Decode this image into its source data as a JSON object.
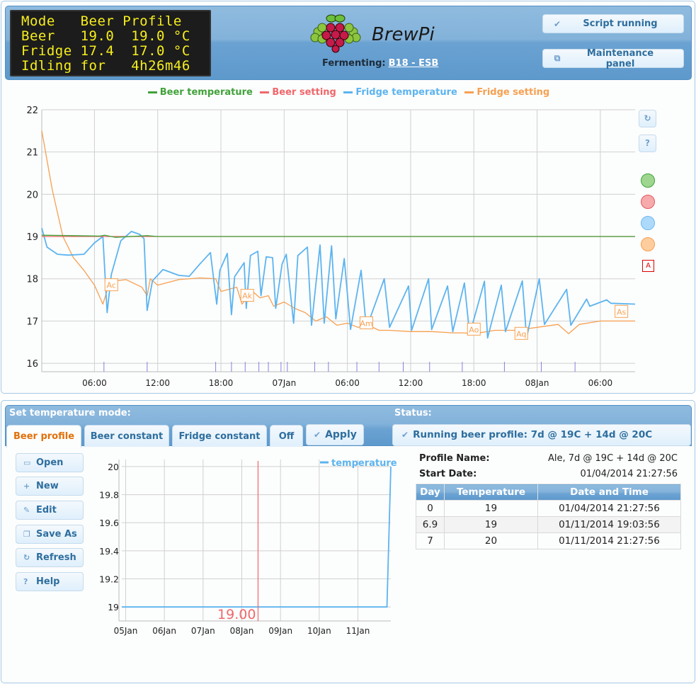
{
  "lcd": {
    "lines": [
      "Mode   Beer Profile",
      "Beer   19.0  19.0 °C",
      "Fridge 17.4  17.0 °C",
      "Idling for   4h26m46"
    ]
  },
  "header": {
    "logo_text": "BrewPi",
    "fermenting_label": "Fermenting:",
    "fermenting_beer": "B18 - ESB",
    "script_button": "Script running",
    "maintenance_button": "Maintenance panel"
  },
  "colors": {
    "beer_temp": "#41a23a",
    "beer_set": "#f0676a",
    "fridge_temp": "#5cb4f0",
    "fridge_set": "#f7a050",
    "accent_orange": "#e17009",
    "button_text": "#2e6e9e"
  },
  "main_chart_controls": {
    "refresh_icon": "↻",
    "help_label": "?",
    "annotation_toggle": "A"
  },
  "chart_data": [
    {
      "type": "line",
      "title": "",
      "xlabel": "",
      "ylabel": "",
      "ylim": [
        15.8,
        22
      ],
      "yticks": [
        16,
        17,
        18,
        19,
        20,
        21,
        22
      ],
      "x_unit": "hours since 06 Jan 00:00",
      "xlim": [
        1,
        57.3
      ],
      "xticks": [
        {
          "x": 6,
          "label": "06:00"
        },
        {
          "x": 12,
          "label": "12:00"
        },
        {
          "x": 18,
          "label": "18:00"
        },
        {
          "x": 24,
          "label": "07Jan"
        },
        {
          "x": 30,
          "label": "06:00"
        },
        {
          "x": 36,
          "label": "12:00"
        },
        {
          "x": 42,
          "label": "18:00"
        },
        {
          "x": 48,
          "label": "08Jan"
        },
        {
          "x": 54,
          "label": "06:00"
        }
      ],
      "legend": [
        "Beer temperature",
        "Beer setting",
        "Fridge temperature",
        "Fridge setting"
      ],
      "legend_position": "top-center",
      "grid": true,
      "series": [
        {
          "name": "Beer temperature",
          "color": "#41a23a",
          "x": [
            1,
            4,
            6.5,
            7,
            8,
            11,
            12,
            18,
            57.3
          ],
          "y": [
            19.03,
            19.02,
            19.01,
            19.03,
            18.98,
            19.02,
            19.0,
            19.0,
            19.0
          ]
        },
        {
          "name": "Beer setting",
          "color": "#f0676a",
          "x": [
            1,
            57.3
          ],
          "y": [
            19.0,
            19.0
          ]
        },
        {
          "name": "Fridge temperature",
          "color": "#5cb4f0",
          "x": [
            1,
            1.5,
            2.5,
            3.5,
            5,
            6,
            6.8,
            7.2,
            7.6,
            8.5,
            9.5,
            10.3,
            10.7,
            11.0,
            11.5,
            12.5,
            14,
            15,
            16,
            17,
            17.6,
            17.9,
            18.6,
            19.0,
            19.3,
            20.2,
            20.4,
            20.8,
            21.5,
            21.8,
            22.3,
            22.9,
            23.2,
            23.8,
            24.2,
            24.9,
            25.3,
            26.2,
            26.6,
            27.4,
            27.8,
            28.5,
            28.9,
            29.7,
            30.3,
            31.3,
            31.8,
            33.5,
            34.0,
            35.8,
            36.1,
            37.7,
            38.0,
            39.5,
            40.0,
            41.1,
            41.6,
            43.0,
            43.3,
            44.6,
            45.0,
            46.6,
            47.0,
            48.2,
            48.7,
            50.8,
            51.2,
            52.7,
            53.0,
            54.6,
            55.0,
            57.3
          ],
          "y": [
            19.2,
            18.75,
            18.58,
            18.56,
            18.58,
            18.85,
            19.0,
            17.2,
            18.1,
            18.9,
            19.12,
            19.05,
            18.95,
            17.25,
            17.95,
            18.22,
            18.08,
            18.06,
            18.35,
            18.62,
            17.4,
            18.2,
            18.6,
            17.15,
            18.05,
            18.38,
            17.3,
            18.55,
            18.65,
            17.6,
            18.52,
            18.5,
            17.3,
            18.35,
            18.58,
            16.95,
            18.55,
            18.75,
            16.9,
            18.8,
            16.95,
            18.78,
            17.05,
            18.48,
            16.8,
            18.2,
            16.82,
            18.0,
            16.85,
            17.83,
            16.78,
            18.0,
            16.8,
            17.83,
            16.75,
            17.9,
            16.68,
            17.94,
            16.6,
            17.85,
            16.75,
            17.95,
            16.6,
            18.0,
            16.92,
            17.75,
            16.9,
            17.52,
            17.35,
            17.5,
            17.42,
            17.4
          ]
        },
        {
          "name": "Fridge setting",
          "color": "#f7a050",
          "x": [
            1,
            2,
            3,
            4,
            5,
            6,
            6.8,
            7.3,
            8,
            9,
            10.5,
            11.0,
            11.3,
            12,
            14,
            16,
            17.5,
            18,
            19.5,
            20,
            21,
            21.7,
            22.5,
            23,
            24,
            25,
            26,
            27,
            28,
            29,
            30,
            31,
            32,
            33,
            34,
            36,
            38,
            40,
            41,
            42,
            44,
            46,
            48,
            50,
            51,
            52,
            54,
            57.3
          ],
          "y": [
            21.5,
            20.1,
            19.0,
            18.5,
            18.2,
            17.85,
            17.4,
            17.8,
            17.95,
            17.98,
            17.8,
            17.6,
            18.0,
            17.85,
            17.98,
            18.02,
            18.0,
            17.7,
            17.8,
            17.4,
            17.7,
            17.55,
            17.6,
            17.35,
            17.45,
            17.3,
            17.2,
            17.0,
            17.1,
            16.9,
            16.95,
            16.85,
            16.9,
            16.78,
            16.78,
            16.75,
            16.75,
            16.72,
            16.72,
            16.7,
            16.78,
            16.78,
            16.85,
            16.92,
            16.7,
            16.92,
            17.0,
            17.0
          ]
        }
      ],
      "annotations": [
        {
          "label": "Ac",
          "x": 7.6,
          "y": 17.85
        },
        {
          "label": "Ak",
          "x": 20.5,
          "y": 17.6
        },
        {
          "label": "Am",
          "x": 31.8,
          "y": 16.95
        },
        {
          "label": "Ao",
          "x": 42.0,
          "y": 16.8
        },
        {
          "label": "Aq",
          "x": 46.5,
          "y": 16.7
        },
        {
          "label": "As",
          "x": 56.0,
          "y": 17.22
        }
      ],
      "event_markers_x": [
        6.9,
        11.0,
        17.5,
        19.0,
        20.3,
        21.6,
        22.5,
        23.7,
        24.3,
        26.9,
        28.2,
        30.9,
        33.0,
        35.3,
        37.8,
        40.9,
        44.9,
        48.4,
        51.6
      ]
    },
    {
      "type": "line",
      "title": "",
      "xlabel": "",
      "ylabel": "",
      "ylim": [
        18.9,
        20.05
      ],
      "yticks": [
        19,
        19.2,
        19.4,
        19.6,
        19.8,
        20
      ],
      "x_unit": "days since 05 Jan 00:00",
      "xlim": [
        -0.1,
        6.85
      ],
      "xticks": [
        {
          "x": 0,
          "label": "05Jan"
        },
        {
          "x": 1,
          "label": "06Jan"
        },
        {
          "x": 2,
          "label": "07Jan"
        },
        {
          "x": 3,
          "label": "08Jan"
        },
        {
          "x": 4,
          "label": "09Jan"
        },
        {
          "x": 5,
          "label": "10Jan"
        },
        {
          "x": 6,
          "label": "11Jan"
        }
      ],
      "legend": [
        "temperature"
      ],
      "legend_position": "top-right",
      "grid": true,
      "series": [
        {
          "name": "temperature",
          "color": "#5cb4f0",
          "x": [
            -0.1,
            6.75,
            6.85
          ],
          "y": [
            19,
            19,
            20
          ]
        }
      ],
      "now_marker": {
        "x": 3.42,
        "label": "19.00",
        "color": "#f0676a"
      }
    }
  ],
  "mode": {
    "title": "Set temperature mode:",
    "tabs": [
      "Beer profile",
      "Beer constant",
      "Fridge constant",
      "Off"
    ],
    "active_tab": 0,
    "apply_label": "Apply"
  },
  "status": {
    "title": "Status:",
    "text": "Running beer profile: 7d @ 19C + 14d @ 20C"
  },
  "profile_buttons": [
    {
      "label": "Open",
      "icon": "folder-open-icon",
      "glyph": "▭"
    },
    {
      "label": "New",
      "icon": "plus-icon",
      "glyph": "+"
    },
    {
      "label": "Edit",
      "icon": "wrench-icon",
      "glyph": "✎"
    },
    {
      "label": "Save As",
      "icon": "copy-icon",
      "glyph": "❐"
    },
    {
      "label": "Refresh",
      "icon": "refresh-icon",
      "glyph": "↻"
    },
    {
      "label": "Help",
      "icon": "help-icon",
      "glyph": "?"
    }
  ],
  "profile": {
    "name_label": "Profile Name:",
    "name_value": "Ale, 7d @ 19C + 14d @ 20C",
    "start_label": "Start Date:",
    "start_value": "01/04/2014 21:27:56",
    "columns": [
      "Day",
      "Temperature",
      "Date and Time"
    ],
    "rows": [
      [
        "0",
        "19",
        "01/04/2014 21:27:56"
      ],
      [
        "6.9",
        "19",
        "01/11/2014 19:03:56"
      ],
      [
        "7",
        "20",
        "01/11/2014 21:27:56"
      ]
    ]
  }
}
